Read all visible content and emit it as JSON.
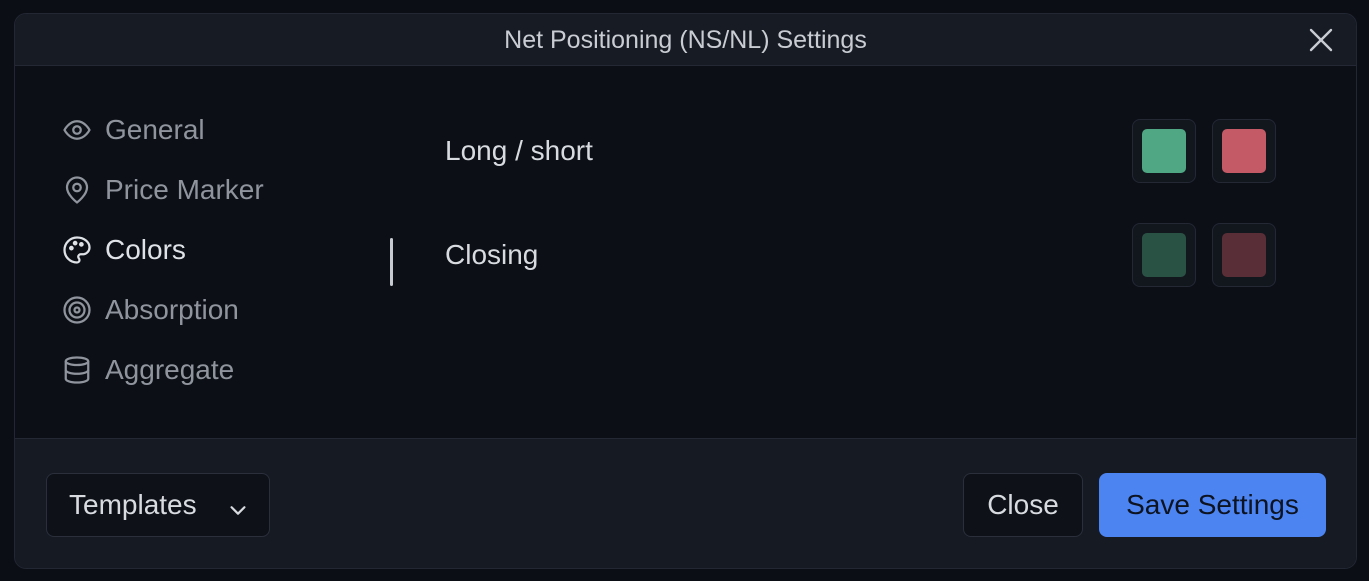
{
  "dialog": {
    "title": "Net Positioning (NS/NL) Settings"
  },
  "sidebar": {
    "items": [
      {
        "label": "General",
        "icon": "eye-icon",
        "active": false
      },
      {
        "label": "Price Marker",
        "icon": "map-pin-icon",
        "active": false
      },
      {
        "label": "Colors",
        "icon": "palette-icon",
        "active": true
      },
      {
        "label": "Absorption",
        "icon": "target-icon",
        "active": false
      },
      {
        "label": "Aggregate",
        "icon": "database-icon",
        "active": false
      }
    ]
  },
  "colors": {
    "rows": [
      {
        "label": "Long / short",
        "long_color": "#4fa883",
        "short_color": "#c45a66"
      },
      {
        "label": "Closing",
        "long_color": "#2a5244",
        "short_color": "#5a2e36"
      }
    ]
  },
  "footer": {
    "templates_label": "Templates",
    "close_label": "Close",
    "save_label": "Save Settings"
  },
  "theme": {
    "accent": "#4c84f2",
    "background": "#0c0f16"
  }
}
